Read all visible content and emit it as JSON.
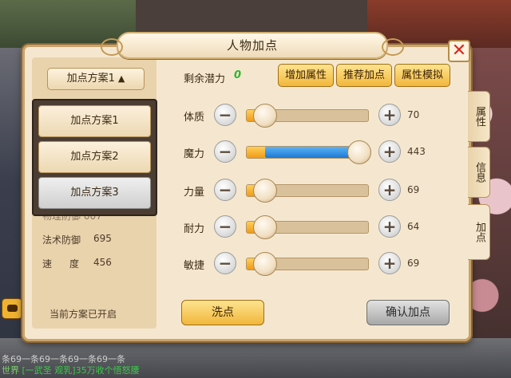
{
  "window": {
    "title": "人物加点"
  },
  "plan_selector": {
    "current": "加点方案1",
    "options": [
      "加点方案1",
      "加点方案2",
      "加点方案3"
    ],
    "selected_index": 2
  },
  "left_stats": {
    "hidden_partial": "物理防御 007",
    "magic_def_label": "法术防御",
    "magic_def_value": "695",
    "speed_label": "速度",
    "speed_value": "456"
  },
  "status_note": "当前方案已开启",
  "potential": {
    "label": "剩余潜力",
    "value": "0"
  },
  "top_buttons": {
    "add": "增加属性",
    "recommend": "推荐加点",
    "simulate": "属性模拟"
  },
  "attributes": [
    {
      "name": "体质",
      "value": "70",
      "fraction": 0.15,
      "blue_fraction": 0
    },
    {
      "name": "魔力",
      "value": "443",
      "fraction": 0.97,
      "blue_fraction": 0.15
    },
    {
      "name": "力量",
      "value": "69",
      "fraction": 0.15,
      "blue_fraction": 0
    },
    {
      "name": "耐力",
      "value": "64",
      "fraction": 0.15,
      "blue_fraction": 0
    },
    {
      "name": "敏捷",
      "value": "69",
      "fraction": 0.15,
      "blue_fraction": 0
    }
  ],
  "actions": {
    "reset": "洗点",
    "confirm": "确认加点"
  },
  "side_tabs": [
    "属性",
    "信息",
    "加点"
  ],
  "chat": {
    "line1": "条69一条69一条69一条69一条",
    "line2_channel": "世界",
    "line2_text": "[一武圣 观乳]35万收个悟怒腰"
  },
  "colors": {
    "accent_gold": "#f1b73a",
    "potential_green": "#2fb52f",
    "blue_fill": "#1d79d3"
  }
}
